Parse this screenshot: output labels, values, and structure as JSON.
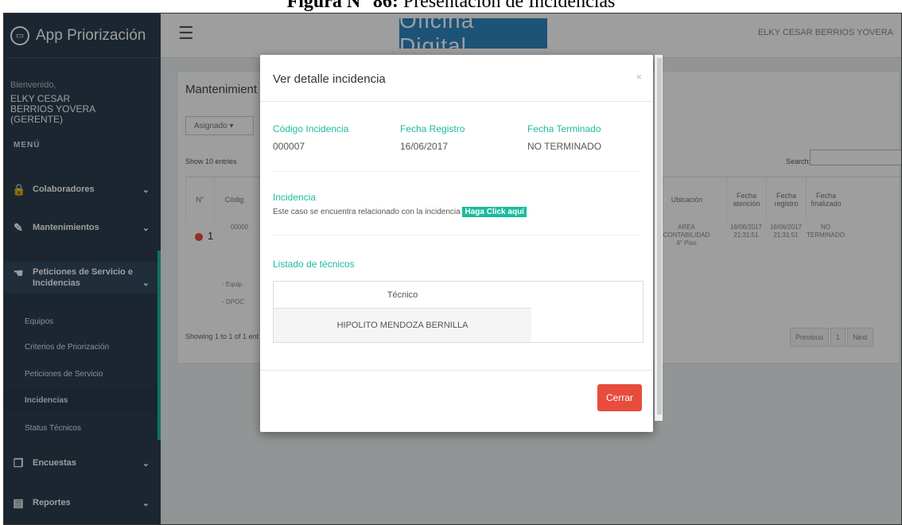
{
  "caption": {
    "bold": "Figura N° 86:",
    "text": " Presentación de Incidencias"
  },
  "sidebar": {
    "brand": "App Priorización",
    "welcome": "Bienvenido,",
    "user_line1": "ELKY CESAR",
    "user_line2": "BERRIOS YOVERA",
    "user_line3": "(GERENTE)",
    "menu_header": "MENÚ",
    "items": [
      {
        "label": "Colaboradores",
        "icon": "lock-icon"
      },
      {
        "label": "Mantenimientos",
        "icon": "edit-icon"
      },
      {
        "label": "Peticiones de Servicio e",
        "label2": "Incidencias",
        "icon": "hand-point-icon"
      },
      {
        "label": "Encuestas",
        "icon": "copy-icon"
      },
      {
        "label": "Reportes",
        "icon": "file-icon"
      }
    ],
    "subitems": [
      "Equipos",
      "Criterios de Priorización",
      "Peticiones de Servicio",
      "Incidencias",
      "Status Técnicos"
    ]
  },
  "topbar": {
    "logo": "Oficina Digital",
    "user": "ELKY CESAR BERRIOS YOVERA"
  },
  "background": {
    "title": "Mantenimient",
    "assigned_btn": "Asignado",
    "show": "Show 10 entries",
    "search_label": "Search:",
    "columns": [
      "N°",
      "Códig",
      "Ubicación",
      "Fecha atención",
      "Fecha registro",
      "Fecha finalizado"
    ],
    "row": {
      "num": "1",
      "code": "00000",
      "ubicacion": "AREA CONTABILIDAD 4° Piso",
      "f_atencion": "16/06/2017 21:31:51",
      "f_registro": "16/06/2017 21:31:51",
      "f_final": "NO TERMINADO"
    },
    "sub1": "- Equip",
    "sub2": "- DPOC",
    "info": "Showing 1 to 1 of 1 ent",
    "pager": [
      "Previous",
      "1",
      "Next"
    ]
  },
  "modal": {
    "title": "Ver detalle incidencia",
    "close": "×",
    "code_label": "Código Incidencia",
    "code_value": "000007",
    "reg_label": "Fecha Registro",
    "reg_value": "16/06/2017",
    "end_label": "Fecha Terminado",
    "end_value": "NO TERMINADO",
    "incidence_label": "Incidencia",
    "incidence_text": "Este caso se encuentra relacionado con la incidencia ",
    "incidence_link": "Haga Click aquí",
    "techs_label": "Listado de técnicos",
    "techs_header": "Técnico",
    "techs": [
      "HIPOLITO MENDOZA BERNILLA"
    ],
    "close_button": "Cerrar"
  },
  "colors": {
    "sidebar": "#2c3e50",
    "accent": "#1abc9c",
    "danger": "#e74c3c",
    "logo_bg": "#2e86c1"
  }
}
